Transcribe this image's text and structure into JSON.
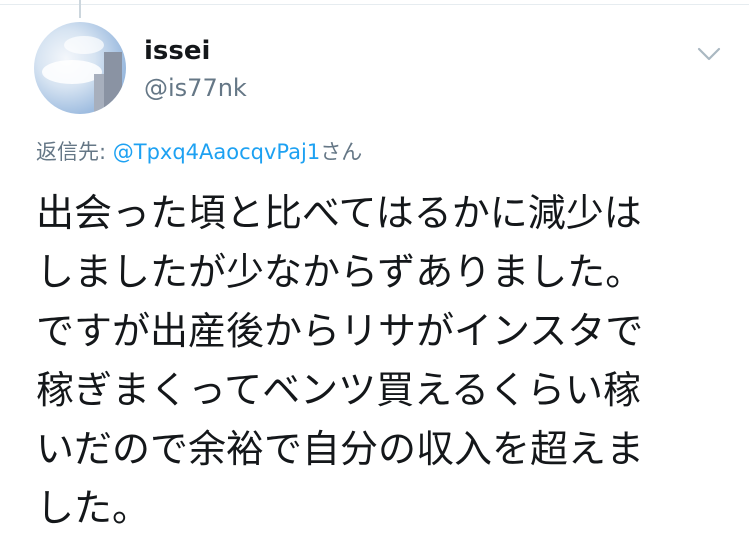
{
  "tweet": {
    "author": {
      "display_name": "issei",
      "handle": "@is77nk"
    },
    "reply_prefix": "返信先: ",
    "reply_to": "@Tpxq4AaocqvPaj1",
    "reply_suffix": "さん",
    "text_lines": [
      "出会った頃と比べてはるかに減少は",
      "しましたが少なからずありました。",
      "ですが出産後からリサがインスタで",
      "稼ぎまくってベンツ買えるくらい稼",
      "いだので余裕で自分の収入を超えま",
      "した。"
    ]
  },
  "icons": {
    "menu": "chevron-down-icon",
    "avatar": "profile-photo"
  },
  "colors": {
    "text": "#14171a",
    "secondary": "#657786",
    "link": "#1da1f2"
  }
}
